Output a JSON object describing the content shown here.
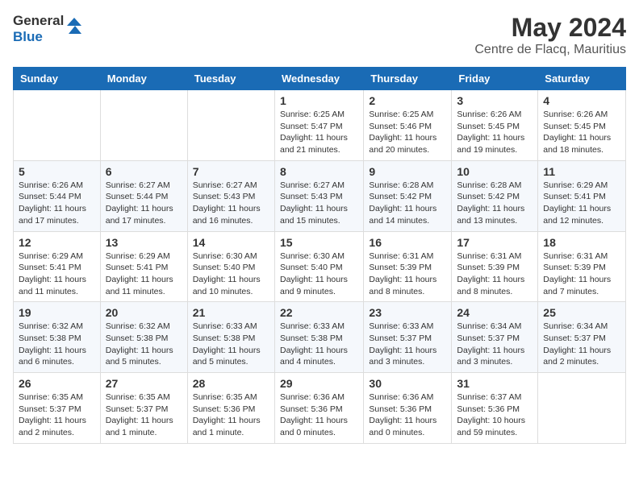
{
  "header": {
    "logo_text_general": "General",
    "logo_text_blue": "Blue",
    "month_year": "May 2024",
    "location": "Centre de Flacq, Mauritius"
  },
  "weekdays": [
    "Sunday",
    "Monday",
    "Tuesday",
    "Wednesday",
    "Thursday",
    "Friday",
    "Saturday"
  ],
  "weeks": [
    [
      {
        "day": "",
        "info": ""
      },
      {
        "day": "",
        "info": ""
      },
      {
        "day": "",
        "info": ""
      },
      {
        "day": "1",
        "info": "Sunrise: 6:25 AM\nSunset: 5:47 PM\nDaylight: 11 hours\nand 21 minutes."
      },
      {
        "day": "2",
        "info": "Sunrise: 6:25 AM\nSunset: 5:46 PM\nDaylight: 11 hours\nand 20 minutes."
      },
      {
        "day": "3",
        "info": "Sunrise: 6:26 AM\nSunset: 5:45 PM\nDaylight: 11 hours\nand 19 minutes."
      },
      {
        "day": "4",
        "info": "Sunrise: 6:26 AM\nSunset: 5:45 PM\nDaylight: 11 hours\nand 18 minutes."
      }
    ],
    [
      {
        "day": "5",
        "info": "Sunrise: 6:26 AM\nSunset: 5:44 PM\nDaylight: 11 hours\nand 17 minutes."
      },
      {
        "day": "6",
        "info": "Sunrise: 6:27 AM\nSunset: 5:44 PM\nDaylight: 11 hours\nand 17 minutes."
      },
      {
        "day": "7",
        "info": "Sunrise: 6:27 AM\nSunset: 5:43 PM\nDaylight: 11 hours\nand 16 minutes."
      },
      {
        "day": "8",
        "info": "Sunrise: 6:27 AM\nSunset: 5:43 PM\nDaylight: 11 hours\nand 15 minutes."
      },
      {
        "day": "9",
        "info": "Sunrise: 6:28 AM\nSunset: 5:42 PM\nDaylight: 11 hours\nand 14 minutes."
      },
      {
        "day": "10",
        "info": "Sunrise: 6:28 AM\nSunset: 5:42 PM\nDaylight: 11 hours\nand 13 minutes."
      },
      {
        "day": "11",
        "info": "Sunrise: 6:29 AM\nSunset: 5:41 PM\nDaylight: 11 hours\nand 12 minutes."
      }
    ],
    [
      {
        "day": "12",
        "info": "Sunrise: 6:29 AM\nSunset: 5:41 PM\nDaylight: 11 hours\nand 11 minutes."
      },
      {
        "day": "13",
        "info": "Sunrise: 6:29 AM\nSunset: 5:41 PM\nDaylight: 11 hours\nand 11 minutes."
      },
      {
        "day": "14",
        "info": "Sunrise: 6:30 AM\nSunset: 5:40 PM\nDaylight: 11 hours\nand 10 minutes."
      },
      {
        "day": "15",
        "info": "Sunrise: 6:30 AM\nSunset: 5:40 PM\nDaylight: 11 hours\nand 9 minutes."
      },
      {
        "day": "16",
        "info": "Sunrise: 6:31 AM\nSunset: 5:39 PM\nDaylight: 11 hours\nand 8 minutes."
      },
      {
        "day": "17",
        "info": "Sunrise: 6:31 AM\nSunset: 5:39 PM\nDaylight: 11 hours\nand 8 minutes."
      },
      {
        "day": "18",
        "info": "Sunrise: 6:31 AM\nSunset: 5:39 PM\nDaylight: 11 hours\nand 7 minutes."
      }
    ],
    [
      {
        "day": "19",
        "info": "Sunrise: 6:32 AM\nSunset: 5:38 PM\nDaylight: 11 hours\nand 6 minutes."
      },
      {
        "day": "20",
        "info": "Sunrise: 6:32 AM\nSunset: 5:38 PM\nDaylight: 11 hours\nand 5 minutes."
      },
      {
        "day": "21",
        "info": "Sunrise: 6:33 AM\nSunset: 5:38 PM\nDaylight: 11 hours\nand 5 minutes."
      },
      {
        "day": "22",
        "info": "Sunrise: 6:33 AM\nSunset: 5:38 PM\nDaylight: 11 hours\nand 4 minutes."
      },
      {
        "day": "23",
        "info": "Sunrise: 6:33 AM\nSunset: 5:37 PM\nDaylight: 11 hours\nand 3 minutes."
      },
      {
        "day": "24",
        "info": "Sunrise: 6:34 AM\nSunset: 5:37 PM\nDaylight: 11 hours\nand 3 minutes."
      },
      {
        "day": "25",
        "info": "Sunrise: 6:34 AM\nSunset: 5:37 PM\nDaylight: 11 hours\nand 2 minutes."
      }
    ],
    [
      {
        "day": "26",
        "info": "Sunrise: 6:35 AM\nSunset: 5:37 PM\nDaylight: 11 hours\nand 2 minutes."
      },
      {
        "day": "27",
        "info": "Sunrise: 6:35 AM\nSunset: 5:37 PM\nDaylight: 11 hours\nand 1 minute."
      },
      {
        "day": "28",
        "info": "Sunrise: 6:35 AM\nSunset: 5:36 PM\nDaylight: 11 hours\nand 1 minute."
      },
      {
        "day": "29",
        "info": "Sunrise: 6:36 AM\nSunset: 5:36 PM\nDaylight: 11 hours\nand 0 minutes."
      },
      {
        "day": "30",
        "info": "Sunrise: 6:36 AM\nSunset: 5:36 PM\nDaylight: 11 hours\nand 0 minutes."
      },
      {
        "day": "31",
        "info": "Sunrise: 6:37 AM\nSunset: 5:36 PM\nDaylight: 10 hours\nand 59 minutes."
      },
      {
        "day": "",
        "info": ""
      }
    ]
  ]
}
